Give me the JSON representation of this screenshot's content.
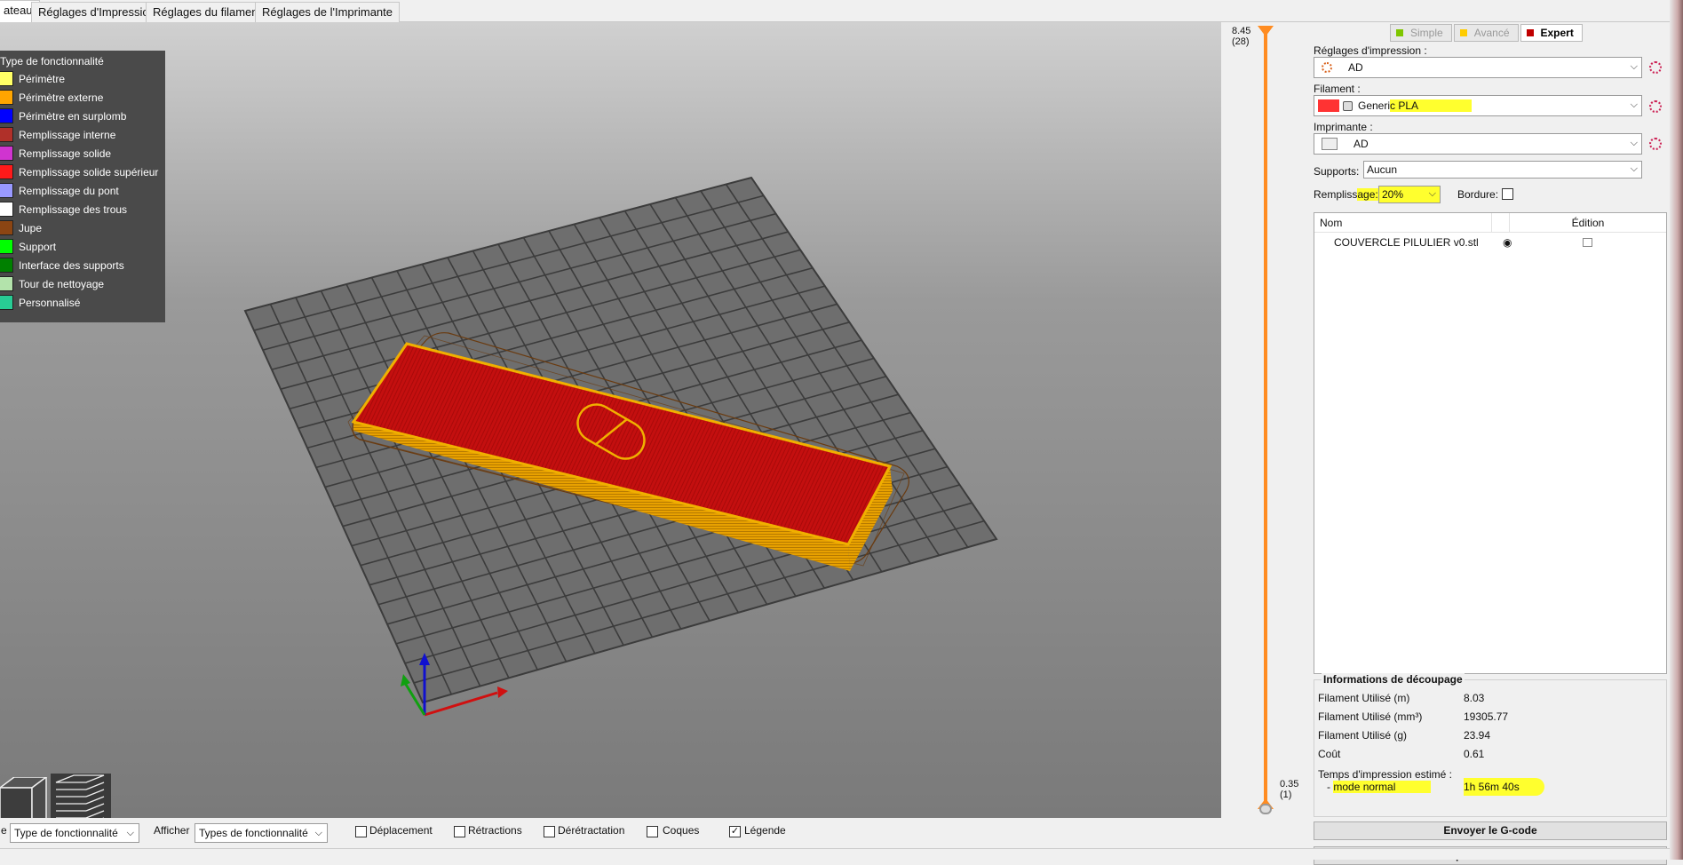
{
  "tabs": [
    {
      "label": "ateau",
      "active": true
    },
    {
      "label": "Réglages d'Impression",
      "active": false
    },
    {
      "label": "Réglages du filament",
      "active": false
    },
    {
      "label": "Réglages de l'Imprimante",
      "active": false
    }
  ],
  "legend": {
    "title": "Type de fonctionnalité",
    "items": [
      {
        "label": "Périmètre",
        "color": "#ffff66"
      },
      {
        "label": "Périmètre externe",
        "color": "#ffa500"
      },
      {
        "label": "Périmètre en surplomb",
        "color": "#0000ff"
      },
      {
        "label": "Remplissage interne",
        "color": "#b03029"
      },
      {
        "label": "Remplissage solide",
        "color": "#d034d0"
      },
      {
        "label": "Remplissage solide supérieur",
        "color": "#ff1a1a"
      },
      {
        "label": "Remplissage du pont",
        "color": "#9999ff"
      },
      {
        "label": "Remplissage des trous",
        "color": "#ffffff"
      },
      {
        "label": "Jupe",
        "color": "#8b4513"
      },
      {
        "label": "Support",
        "color": "#00ff00"
      },
      {
        "label": "Interface des supports",
        "color": "#008000"
      },
      {
        "label": "Tour de nettoyage",
        "color": "#b3e3ab"
      },
      {
        "label": "Personnalisé",
        "color": "#28cc94"
      }
    ]
  },
  "slider": {
    "top_value": "8.45",
    "top_layer": "(28)",
    "bottom_value": "0.35",
    "bottom_layer": "(1)"
  },
  "modes": [
    {
      "label": "Simple",
      "color": "#7fc600",
      "active": false
    },
    {
      "label": "Avancé",
      "color": "#ffcc00",
      "active": false
    },
    {
      "label": "Expert",
      "color": "#c00000",
      "active": true
    }
  ],
  "print_settings": {
    "label": "Réglages d'impression :",
    "value": "AD"
  },
  "filament": {
    "label": "Filament :",
    "value_a": "Generi",
    "value_b": "c PLA",
    "color": "#ff3333"
  },
  "printer": {
    "label": "Imprimante :",
    "value": "AD"
  },
  "supports": {
    "label": "Supports:",
    "value": "Aucun"
  },
  "infill": {
    "label_a": "Rempliss",
    "label_b": "age:",
    "value": "20%"
  },
  "brim": {
    "label": "Bordure:",
    "checked": false
  },
  "objects": {
    "col_name": "Nom",
    "col_edit": "Édition",
    "rows": [
      {
        "name": "COUVERCLE PILULIER v0.stl"
      }
    ]
  },
  "slice_info": {
    "title": "Informations de découpage",
    "rows": [
      {
        "label": "Filament Utilisé (m)",
        "value": "8.03"
      },
      {
        "label": "Filament Utilisé (mm³)",
        "value": "19305.77"
      },
      {
        "label": "Filament Utilisé (g)",
        "value": "23.94"
      },
      {
        "label": "Coût",
        "value": "0.61"
      }
    ],
    "time_label": "Temps d'impression estimé :",
    "mode_prefix": "- ",
    "mode_label": "mode normal",
    "mode_value": "1h 56m 40s"
  },
  "buttons": {
    "send": "Envoyer le G-code",
    "export": "Exporter le G-code"
  },
  "bottom": {
    "view_partial": "e",
    "view_value": "Type de fonctionnalité",
    "show_label": "Afficher",
    "show_value": "Types de fonctionnalité",
    "checks": [
      {
        "label": "Déplacement",
        "checked": false
      },
      {
        "label": "Rétractions",
        "checked": false
      },
      {
        "label": "Dérétractation",
        "checked": false
      },
      {
        "label": "Coques",
        "checked": false
      },
      {
        "label": "Légende",
        "checked": true
      }
    ]
  }
}
